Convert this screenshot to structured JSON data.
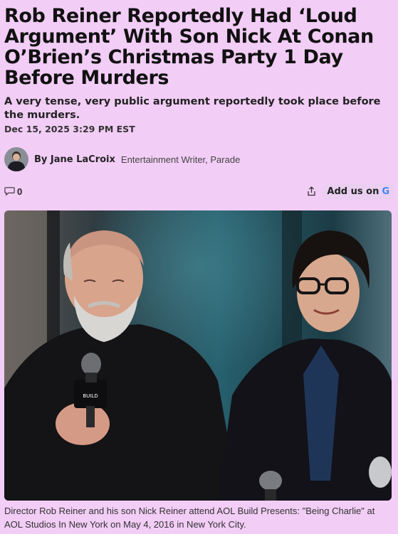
{
  "article": {
    "headline": "Rob Reiner Reportedly Had ‘Loud Argument’ With Son Nick At Conan O’Brien’s Christmas Party 1 Day Before Murders",
    "dek": "A very tense, very public argument reportedly took place before the murders.",
    "date": "Dec 15, 2025 3:29 PM EST",
    "author": {
      "by_label": "By Jane LaCroix",
      "role": "Entertainment Writer, Parade"
    },
    "comments_count": "0",
    "add_us_label": "Add us on",
    "google_glyph": "G",
    "photo": {
      "caption": "Director Rob Reiner and his son Nick Reiner attend AOL Build Presents: \"Being Charlie\" at AOL Studios In New York on May 4, 2016 in New York City.",
      "mic_text": "BUILD"
    }
  },
  "colors": {
    "page_background": "#f2cdf6",
    "google_blue": "#4285f4"
  },
  "icons": [
    "comment-icon",
    "share-icon",
    "google-icon"
  ]
}
